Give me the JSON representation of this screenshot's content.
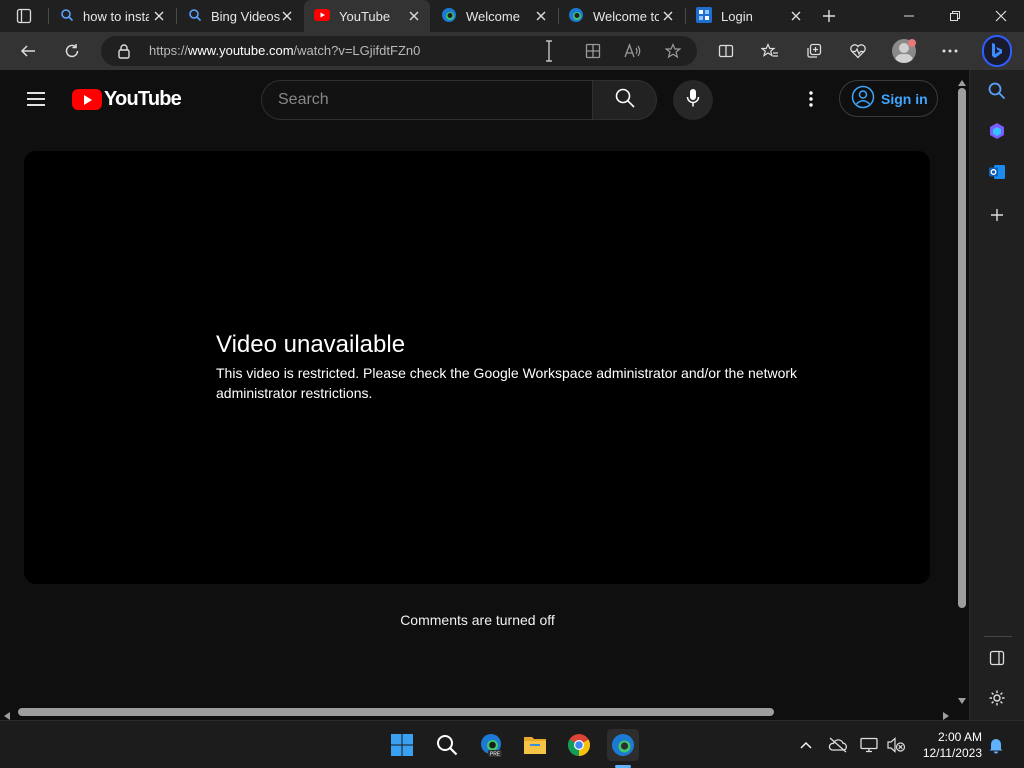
{
  "browser": {
    "tabs": [
      {
        "title": "how to insta",
        "icon": "search-icon",
        "active": false
      },
      {
        "title": "Bing Videos",
        "icon": "search-icon",
        "active": false
      },
      {
        "title": "YouTube",
        "icon": "youtube-icon",
        "active": true
      },
      {
        "title": "Welcome",
        "icon": "edge-icon",
        "active": false
      },
      {
        "title": "Welcome to",
        "icon": "edge-icon",
        "active": false
      },
      {
        "title": "Login",
        "icon": "grid-icon",
        "active": false
      }
    ],
    "address": {
      "prefix": "https://",
      "host": "www.youtube.com",
      "path": "/watch?v=LGjifdtFZn0"
    }
  },
  "youtube": {
    "logo_text": "YouTube",
    "search_placeholder": "Search",
    "sign_in_label": "Sign in",
    "video_unavailable_title": "Video unavailable",
    "video_unavailable_message": "This video is restricted. Please check the Google Workspace administrator and/or the network administrator restrictions.",
    "comments_status": "Comments are turned off"
  },
  "taskbar": {
    "time": "2:00 AM",
    "date": "12/11/2023"
  },
  "colors": {
    "youtube_red": "#ff0000",
    "signin_blue": "#3ea6ff",
    "page_bg": "#0f0f0f",
    "edge_toolbar": "#333333"
  }
}
